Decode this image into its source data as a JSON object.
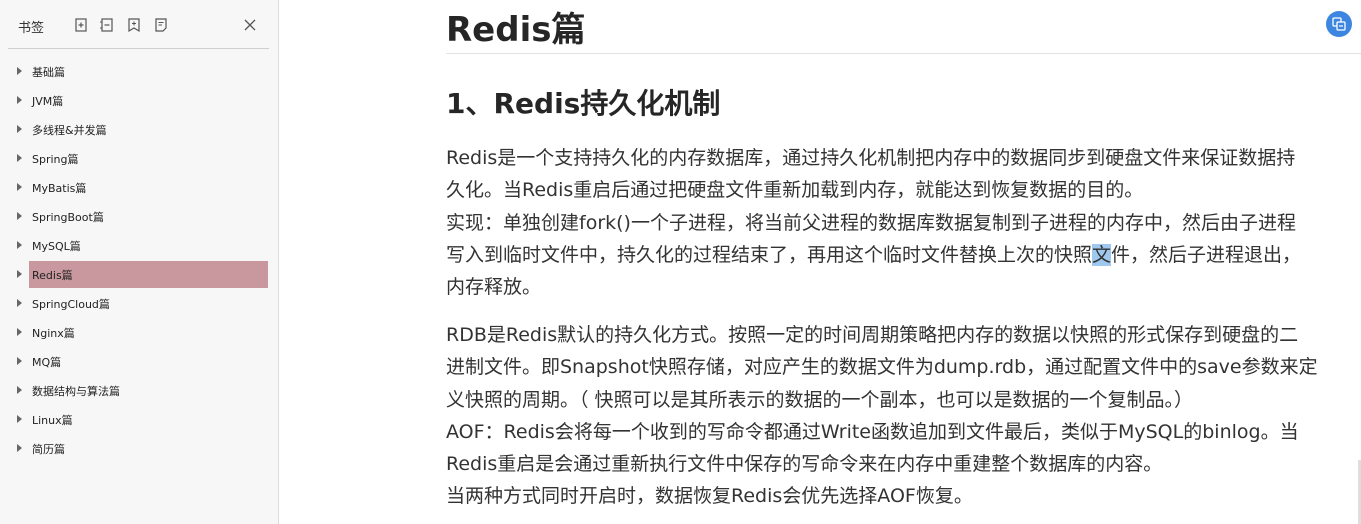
{
  "sidebar": {
    "title": "书签",
    "tools": [
      {
        "icon": "expand-all-icon"
      },
      {
        "icon": "collapse-all-icon"
      },
      {
        "icon": "add-bookmark-icon"
      },
      {
        "icon": "bookmark-list-icon"
      }
    ],
    "close_icon": "close-icon",
    "items": [
      {
        "label": "基础篇"
      },
      {
        "label": "JVM篇"
      },
      {
        "label": "多线程&并发篇"
      },
      {
        "label": "Spring篇"
      },
      {
        "label": "MyBatis篇"
      },
      {
        "label": "SpringBoot篇"
      },
      {
        "label": "MySQL篇"
      },
      {
        "label": "Redis篇",
        "selected": true
      },
      {
        "label": "SpringCloud篇"
      },
      {
        "label": "Nginx篇"
      },
      {
        "label": "MQ篇"
      },
      {
        "label": "数据结构与算法篇"
      },
      {
        "label": "Linux篇"
      },
      {
        "label": "简历篇"
      }
    ]
  },
  "document": {
    "title": "Redis篇",
    "section_heading": "1、Redis持久化机制",
    "paragraph1": [
      "Redis是一个支持持久化的内存数据库，通过持久化机制把内存中的数据同步到硬盘文件来保证数据持",
      "久化。当Redis重启后通过把硬盘文件重新加载到内存，就能达到恢复数据的目的。",
      "实现：单独创建fork()一个子进程，将当前父进程的数据库数据复制到子进程的内存中，然后由子进程",
      {
        "before": "写入到临时文件中，持久化的过程结束了，再用这个临时文件替换上次的快照",
        "highlight": "文",
        "after": "件，然后子进程退出，"
      },
      "内存释放。"
    ],
    "paragraph2": [
      "RDB是Redis默认的持久化方式。按照一定的时间周期策略把内存的数据以快照的形式保存到硬盘的二",
      "进制文件。即Snapshot快照存储，对应产生的数据文件为dump.rdb，通过配置文件中的save参数来定",
      "义快照的周期。（ 快照可以是其所表示的数据的一个副本，也可以是数据的一个复制品。）",
      "AOF：Redis会将每一个收到的写命令都通过Write函数追加到文件最后，类似于MySQL的binlog。当",
      "Redis重启是会通过重新执行文件中保存的写命令来在内存中重建整个数据库的内容。",
      "当两种方式同时开启时，数据恢复Redis会优先选择AOF恢复。"
    ]
  },
  "floating_button": {
    "icon": "translate-icon"
  },
  "colors": {
    "sidebar_bg": "#f7f7f7",
    "selected_item": "#c8989e",
    "text_highlight": "#9ec8ee",
    "floating_button": "#3c86e0"
  }
}
